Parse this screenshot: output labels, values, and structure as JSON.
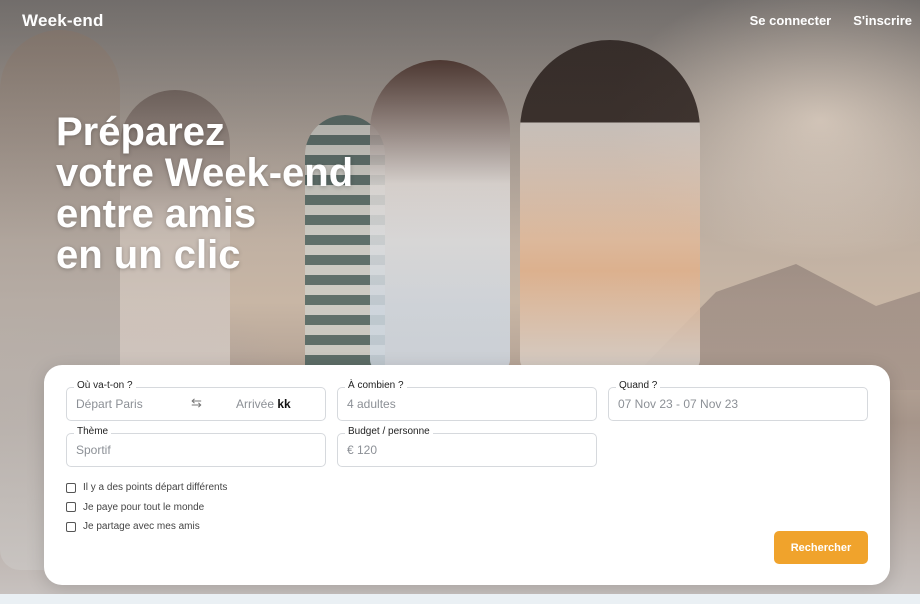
{
  "header": {
    "brand": "Week-end",
    "nav": {
      "login": "Se connecter",
      "signup": "S'inscrire"
    }
  },
  "hero": {
    "headline_lines": [
      "Préparez",
      "votre Week-end",
      "entre amis",
      "en un clic"
    ]
  },
  "search": {
    "destination": {
      "label": "Où va-t-on ?",
      "departure_placeholder": "Départ Paris",
      "arrival_placeholder": "Arrivée",
      "arrival_value": "kk",
      "swap_icon": "swap-arrows-icon"
    },
    "people": {
      "label": "À combien ?",
      "placeholder": "4 adultes"
    },
    "dates": {
      "label": "Quand ?",
      "value": "07 Nov 23 - 07 Nov 23"
    },
    "theme": {
      "label": "Thème",
      "value": "Sportif"
    },
    "budget": {
      "label": "Budget / personne",
      "value": "€ 120"
    },
    "checkboxes": [
      "Il y a des points départ différents",
      "Je paye pour tout le monde",
      "Je partage avec mes amis"
    ],
    "submit": "Rechercher"
  },
  "colors": {
    "accent": "#f0a32c",
    "text_on_hero": "#ffffff"
  }
}
